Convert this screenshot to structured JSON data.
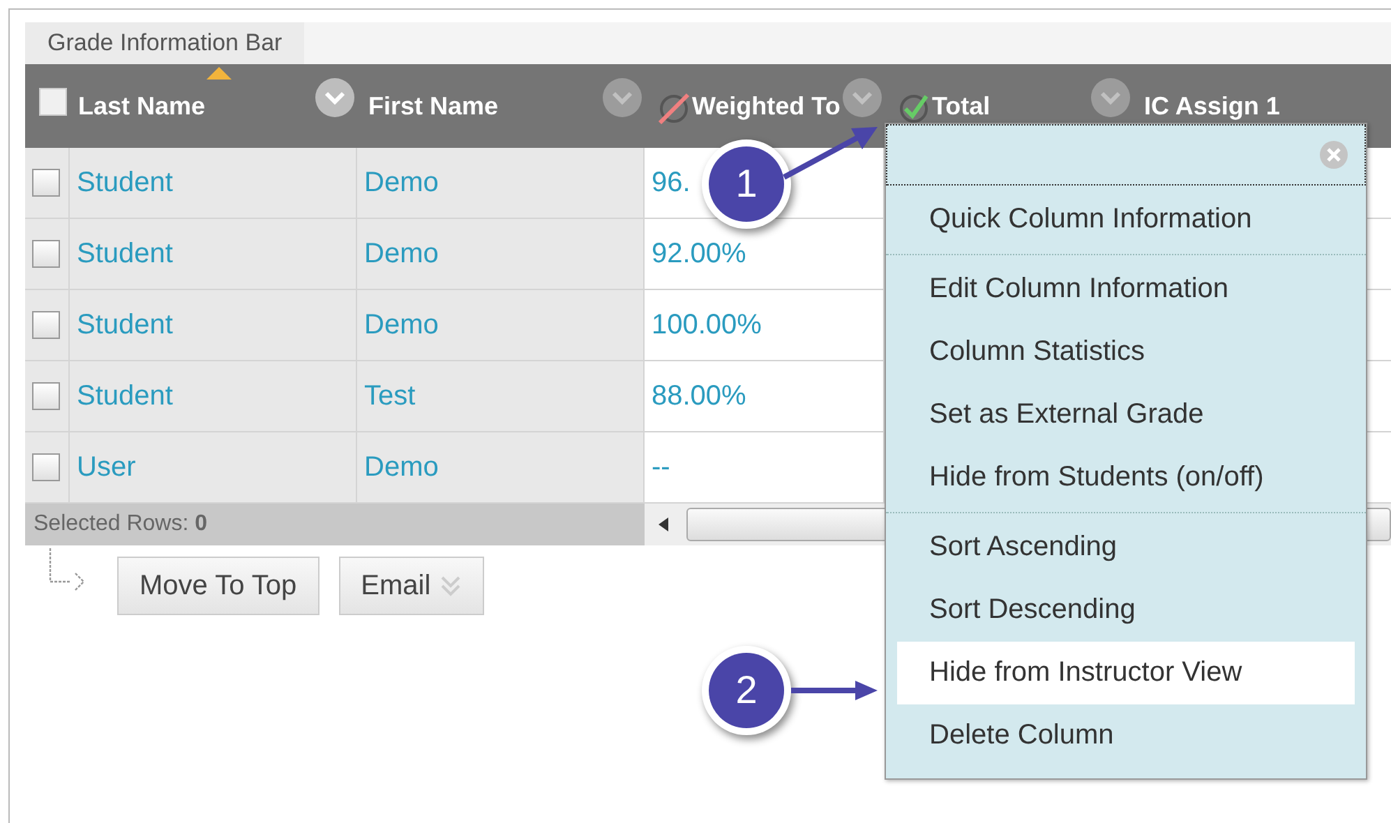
{
  "tab": {
    "label": "Grade Information Bar"
  },
  "select_all": {
    "checked": false
  },
  "columns": [
    {
      "label": "Last Name",
      "kind": "name",
      "sorted": true
    },
    {
      "label": "First Name",
      "kind": "name",
      "sorted": false
    },
    {
      "label": "Weighted To",
      "kind": "hidden-grade",
      "sorted": false
    },
    {
      "label": "Total",
      "kind": "external-grade",
      "sorted": false
    },
    {
      "label": "IC Assign 1",
      "kind": "name",
      "sorted": false
    }
  ],
  "rows": [
    {
      "checked": false,
      "last_name": "Student",
      "first_name": "Demo",
      "weighted": "96."
    },
    {
      "checked": false,
      "last_name": "Student",
      "first_name": "Demo",
      "weighted": "92.00%"
    },
    {
      "checked": false,
      "last_name": "Student",
      "first_name": "Demo",
      "weighted": "100.00%"
    },
    {
      "checked": false,
      "last_name": "Student",
      "first_name": "Test",
      "weighted": "88.00%"
    },
    {
      "checked": false,
      "last_name": "User",
      "first_name": "Demo",
      "weighted": "--"
    }
  ],
  "footer": {
    "selected_rows": "Selected Rows: **0**"
  },
  "actions": [
    {
      "label": "Move To Top",
      "kind": "plain"
    },
    {
      "label": "Email",
      "kind": "dropdown"
    }
  ],
  "context_menu": {
    "groups": [
      [
        {
          "label": "Quick Column Information",
          "selected": false
        }
      ],
      [
        {
          "label": "Edit Column Information",
          "selected": false
        },
        {
          "label": "Column Statistics",
          "selected": false
        },
        {
          "label": "Set as External Grade",
          "selected": false
        },
        {
          "label": "Hide from Students (on/off)",
          "selected": false
        }
      ],
      [
        {
          "label": "Sort Ascending",
          "selected": false
        },
        {
          "label": "Sort Descending",
          "selected": false
        },
        {
          "label": "Hide from Instructor View",
          "selected": true
        },
        {
          "label": "Delete Column",
          "selected": false
        }
      ]
    ]
  },
  "callouts": [
    {
      "label": "1"
    },
    {
      "label": "2"
    }
  ]
}
